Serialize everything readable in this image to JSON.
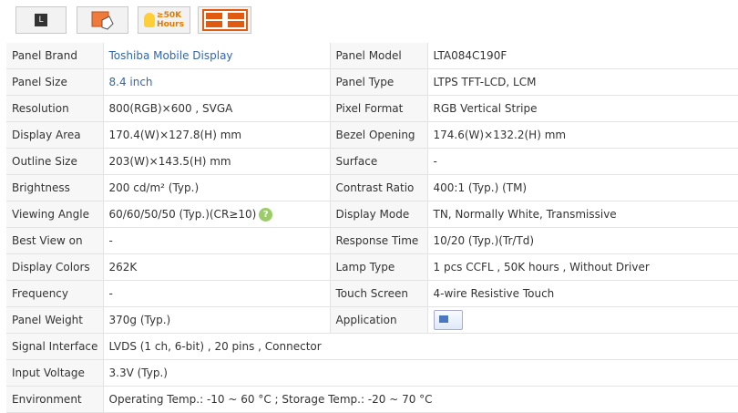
{
  "badges": {
    "led": "L",
    "hours_top": "≥50K",
    "hours_bottom": "Hours"
  },
  "rows": [
    {
      "l1": "Panel Brand",
      "v1": "Toshiba Mobile Display",
      "l2": "Panel Model",
      "v2": "LTA084C190F"
    },
    {
      "l1": "Panel Size",
      "v1": "8.4 inch",
      "l2": "Panel Type",
      "v2": "LTPS TFT-LCD, LCM"
    },
    {
      "l1": "Resolution",
      "v1": "800(RGB)×600 , SVGA",
      "l2": "Pixel Format",
      "v2": "RGB Vertical Stripe"
    },
    {
      "l1": "Display Area",
      "v1": "170.4(W)×127.8(H) mm",
      "l2": "Bezel Opening",
      "v2": "174.6(W)×132.2(H) mm"
    },
    {
      "l1": "Outline Size",
      "v1": "203(W)×143.5(H) mm",
      "l2": "Surface",
      "v2": "-"
    },
    {
      "l1": "Brightness",
      "v1": "200 cd/m² (Typ.)",
      "l2": "Contrast Ratio",
      "v2": "400:1 (Typ.) (TM)"
    },
    {
      "l1": "Viewing Angle",
      "v1": "60/60/50/50 (Typ.)(CR≥10)",
      "l2": "Display Mode",
      "v2": "TN, Normally White, Transmissive"
    },
    {
      "l1": "Best View on",
      "v1": "-",
      "l2": "Response Time",
      "v2": "10/20 (Typ.)(Tr/Td)"
    },
    {
      "l1": "Display Colors",
      "v1": "262K",
      "l2": "Lamp Type",
      "v2": "1 pcs CCFL , 50K hours , Without Driver"
    },
    {
      "l1": "Frequency",
      "v1": "-",
      "l2": "Touch Screen",
      "v2": "4-wire Resistive Touch"
    },
    {
      "l1": "Panel Weight",
      "v1": "370g (Typ.)",
      "l2": "Application",
      "v2": ""
    }
  ],
  "wide_rows": [
    {
      "l": "Signal Interface",
      "v": "LVDS (1 ch, 6-bit) , 20 pins , Connector"
    },
    {
      "l": "Input Voltage",
      "v": "3.3V (Typ.)"
    },
    {
      "l": "Environment",
      "v": "Operating Temp.: -10 ~ 60 °C ; Storage Temp.: -20 ~ 70 °C"
    }
  ],
  "help_icon": "?"
}
